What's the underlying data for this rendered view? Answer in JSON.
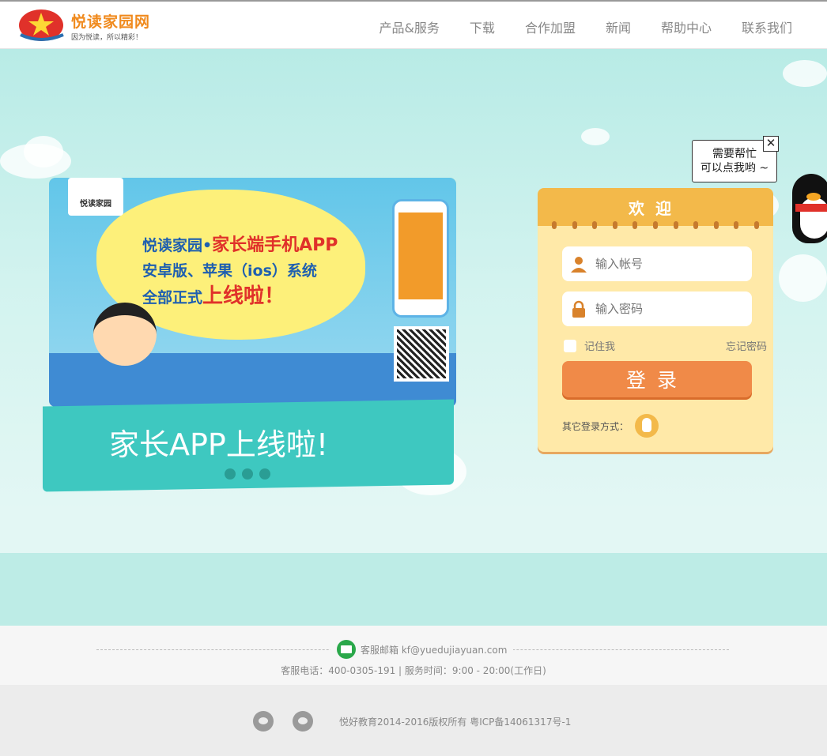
{
  "header": {
    "logo_name": "悦读家园网",
    "logo_slogan": "因为悦读，所以精彩！",
    "nav": [
      "产品&服务",
      "下载",
      "合作加盟",
      "新闻",
      "帮助中心",
      "联系我们"
    ]
  },
  "banner": {
    "promo": {
      "logo_card": "悦读家园",
      "headline_line1_blue": "悦读家园•",
      "headline_line1_red": "家长端手机APP",
      "headline_line2": "安卓版、苹果（ios）系统",
      "headline_line3_blue": "全部正式",
      "headline_line3_red": "上线啦！",
      "band_title": "家长APP上线啦!",
      "slide_count": 3
    },
    "help_bubble": {
      "line1": "需要帮忙",
      "line2": "可以点我哟 ~",
      "close": "✕"
    }
  },
  "login": {
    "title": "欢迎",
    "account_placeholder": "输入帐号",
    "password_placeholder": "输入密码",
    "remember_label": "记住我",
    "forgot_label": "忘记密码",
    "submit_label": "登录",
    "other_login_label": "其它登录方式："
  },
  "contact": {
    "email_text": "客服邮箱 kf@yuedujiayuan.com",
    "tel_text": "客服电话：400-0305-191 | 服务时间：9:00 - 20:00(工作日)"
  },
  "footer": {
    "copyright": "悦好教育2014-2016版权所有    粤ICP备14061317号-1"
  },
  "colors": {
    "accent_orange": "#f08a48",
    "banner_teal": "#3ec8c0",
    "panel_yellow": "#ffe9a8"
  }
}
